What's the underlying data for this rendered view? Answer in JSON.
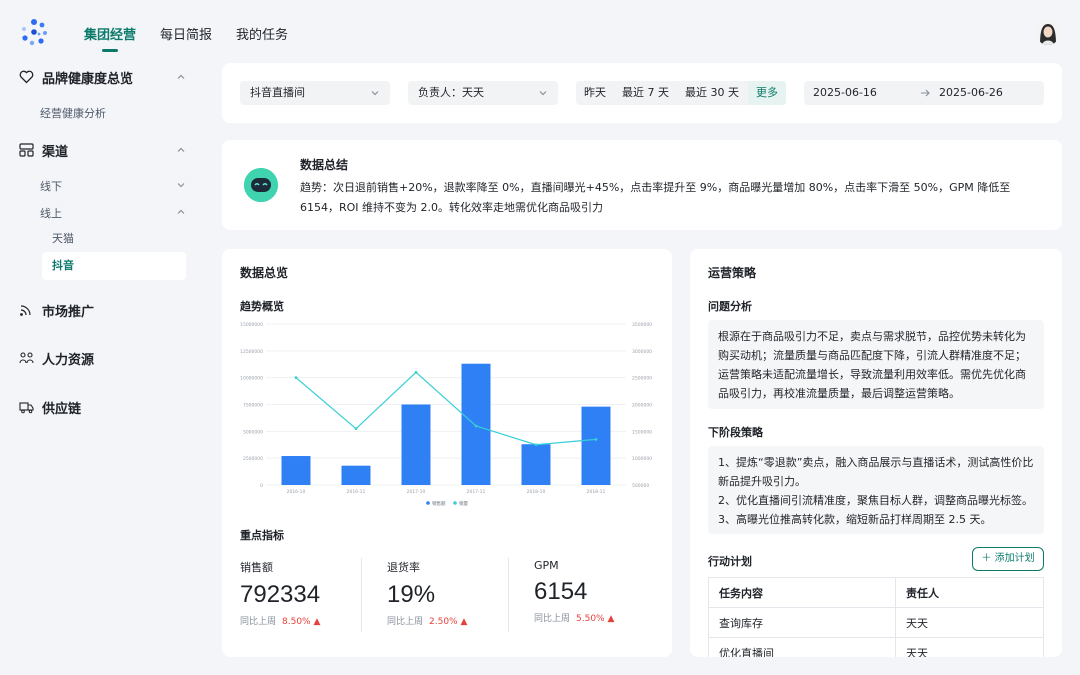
{
  "nav": {
    "tabs": [
      {
        "label": "集团经营",
        "active": true
      },
      {
        "label": "每日简报"
      },
      {
        "label": "我的任务"
      }
    ]
  },
  "sidebar": {
    "brand_health": {
      "label": "品牌健康度总览",
      "icon": "heart-icon",
      "items": [
        "经营健康分析"
      ]
    },
    "channel": {
      "label": "渠道",
      "icon": "channel-icon",
      "offline": "线下",
      "online": "线上",
      "online_items": [
        {
          "label": "天猫"
        },
        {
          "label": "抖音",
          "active": true
        }
      ]
    },
    "marketing": {
      "label": "市场推广",
      "icon": "signal-icon"
    },
    "hr": {
      "label": "人力资源",
      "icon": "people-icon"
    },
    "supply": {
      "label": "供应链",
      "icon": "truck-icon"
    }
  },
  "filters": {
    "channel": "抖音直播间",
    "owner": "负责人：天天",
    "ranges": [
      "昨天",
      "最近 7 天",
      "最近 30 天"
    ],
    "more": "更多",
    "date_start": "2025-06-16",
    "date_end": "2025-06-26"
  },
  "summary": {
    "title": "数据总结",
    "text": "趋势：次日退前销售+20%，退款率降至 0%，直播间曝光+45%，点击率提升至 9%，商品曝光量增加 80%，点击率下滑至 50%，GPM 降低至 6154，ROI 维持不变为 2.0。转化效率走地需优化商品吸引力"
  },
  "overview": {
    "title": "数据总览",
    "trend_title": "趋势概览",
    "kpi_title": "重点指标",
    "kpis": [
      {
        "label": "销售额",
        "value": "792334",
        "compare": "同比上周",
        "change": "8.50%"
      },
      {
        "label": "退货率",
        "value": "19%",
        "compare": "同比上周",
        "change": "2.50%"
      },
      {
        "label": "GPM",
        "value": "6154",
        "compare": "同比上周",
        "change": "5.50%"
      }
    ]
  },
  "chart_data": {
    "type": "bar",
    "categories": [
      "2016-10",
      "2016-11",
      "2017-10",
      "2017-11",
      "2018-10",
      "2018-11"
    ],
    "series": [
      {
        "name": "销售额",
        "type": "bar",
        "axis": "left",
        "values": [
          2700000,
          1800000,
          7500000,
          11300000,
          3800000,
          7300000
        ],
        "color": "#2f7ff5"
      },
      {
        "name": "销量",
        "type": "line",
        "axis": "right",
        "values": [
          2500000,
          1550000,
          2600000,
          1600000,
          1250000,
          1350000
        ],
        "color": "#36cfd6"
      }
    ],
    "y_left": {
      "ticks": [
        0,
        2500000,
        5000000,
        7500000,
        10000000,
        12500000,
        15000000
      ],
      "lim": [
        0,
        15000000
      ]
    },
    "y_right": {
      "ticks": [
        500000,
        1000000,
        1500000,
        2000000,
        2500000,
        3000000,
        3500000
      ],
      "lim": [
        500000,
        3500000
      ]
    },
    "legend_position": "bottom",
    "grid": true
  },
  "strategy": {
    "title": "运营策略",
    "problem_title": "问题分析",
    "problem_text": "根源在于商品吸引力不足，卖点与需求脱节，品控优势未转化为购买动机；流量质量与商品匹配度下降，引流人群精准度不足；运营策略未适配流量增长，导致流量利用效率低。需优先优化商品吸引力，再校准流量质量，最后调整运营策略。",
    "next_title": "下阶段策略",
    "next_items": [
      "1、提炼“零退款”卖点，融入商品展示与直播话术，测试高性价比新品提升吸引力。",
      "2、优化直播间引流精准度，聚焦目标人群，调整商品曝光标签。",
      "3、高曝光位推高转化款，缩短新品打样周期至 2.5 天。"
    ],
    "action_title": "行动计划",
    "add_button": "添加计划",
    "table": {
      "headers": [
        "任务内容",
        "责任人"
      ],
      "rows": [
        [
          "查询库存",
          "天天"
        ],
        [
          "优化直播间",
          "天天"
        ]
      ]
    }
  },
  "colors": {
    "accent": "#0c7a6b",
    "bar": "#2f7ff5",
    "line": "#36cfd6",
    "up": "#e8413c"
  }
}
